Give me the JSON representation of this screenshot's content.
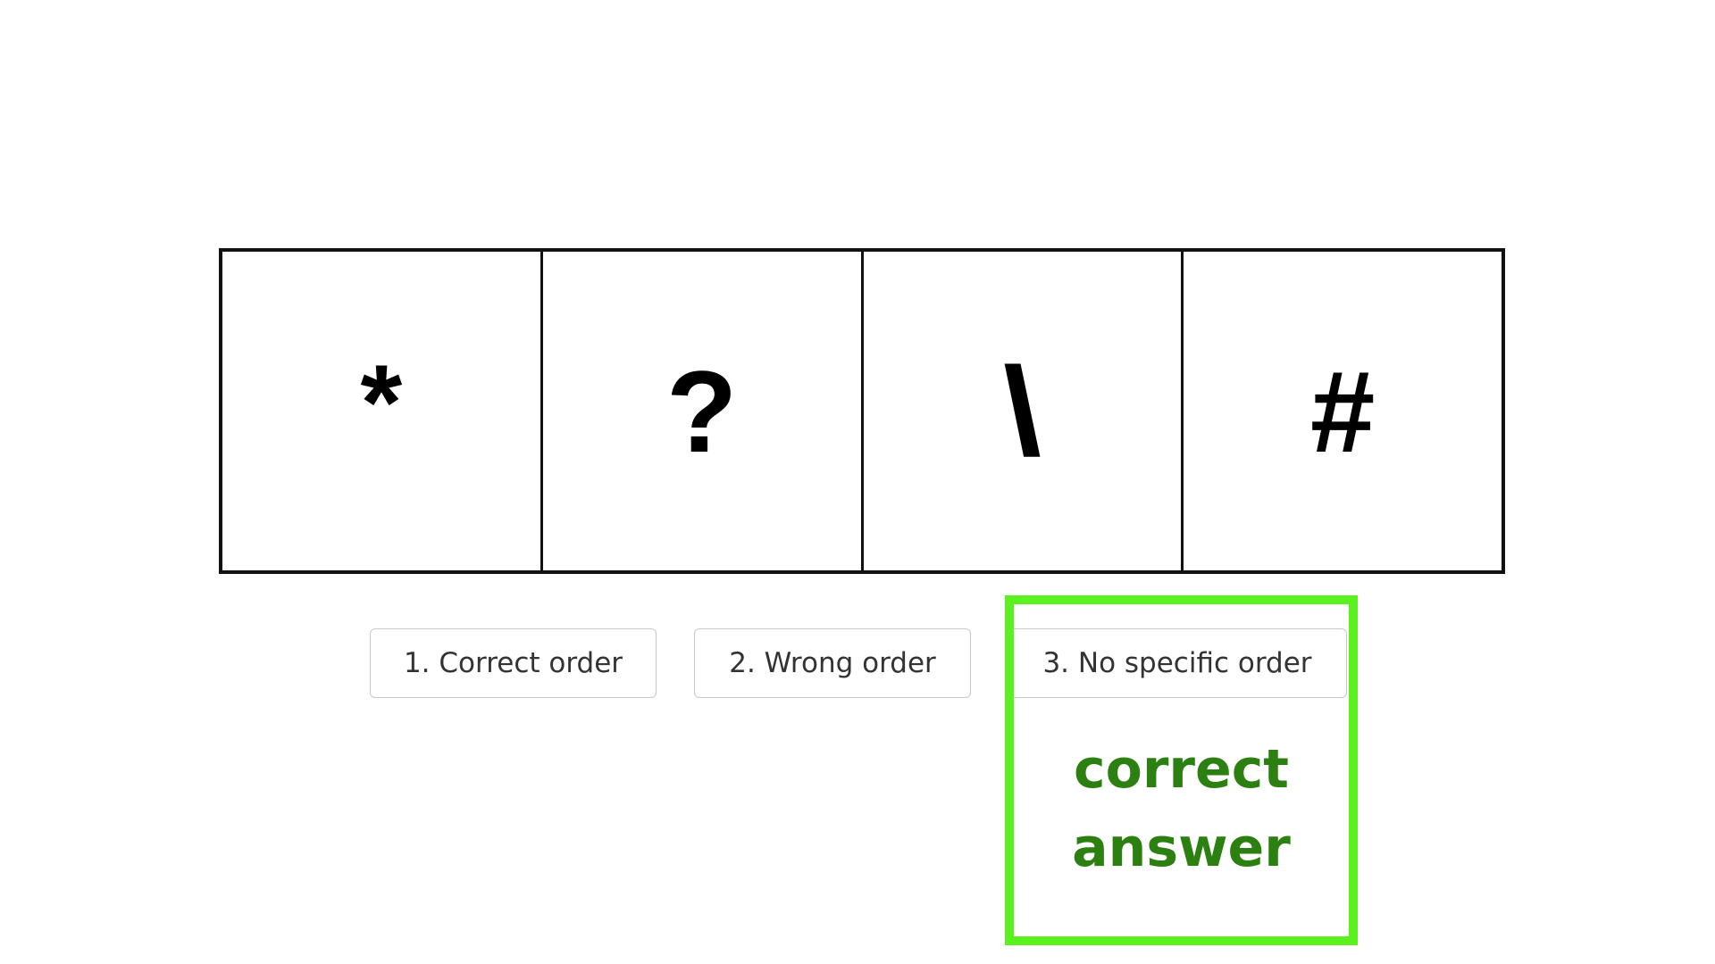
{
  "symbols": [
    "*",
    "?",
    "\\",
    "#"
  ],
  "options": [
    {
      "label": "1. Correct order"
    },
    {
      "label": "2. Wrong order"
    },
    {
      "label": "3. No specific order"
    }
  ],
  "answer": {
    "line1": "correct",
    "line2": "answer",
    "highlight_color": "#5af11e",
    "text_color": "#2c8012"
  }
}
